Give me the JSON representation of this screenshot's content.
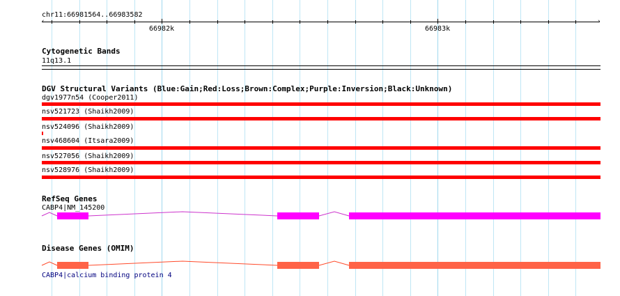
{
  "ruler": {
    "coordinates": "chr11:66981564..66983582",
    "ticks": [
      "66982k",
      "66983k"
    ]
  },
  "tracks": {
    "cytoband": {
      "title": "Cytogenetic Bands",
      "band": "11q13.1"
    },
    "dgv": {
      "title": "DGV Structural Variants (Blue:Gain;Red:Loss;Brown:Complex;Purple:Inversion;Black:Unknown)",
      "variants": [
        "dgv1977n54 (Cooper2011)",
        "nsv521723 (Shaikh2009)",
        "nsv524096 (Shaikh2009)",
        "nsv468604 (Itsara2009)",
        "nsv527056 (Shaikh2009)",
        "nsv528976 (Shaikh2009)"
      ],
      "color": "#ff0000"
    },
    "refseq": {
      "title": "RefSeq Genes",
      "gene": "CABP4|NM_145200",
      "color": "#ff00ff",
      "intron_color": "#cc33cc"
    },
    "omim": {
      "title": "Disease Genes (OMIM)",
      "gene": "CABP4|calcium binding protein 4",
      "color": "#ff6347",
      "intron_color": "#ff4a2a"
    }
  }
}
